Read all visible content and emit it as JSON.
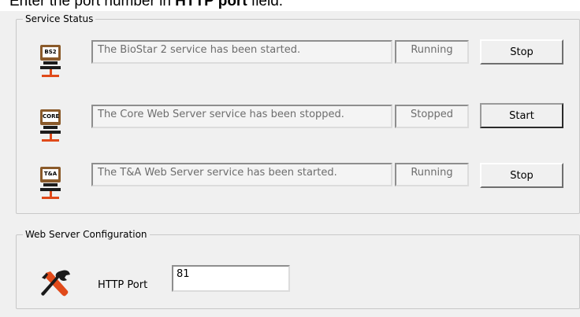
{
  "caption": {
    "before": "Enter the port number in ",
    "bold": "HTTP port",
    "after": " field."
  },
  "service_status": {
    "title": "Service Status",
    "services": [
      {
        "icon_text": "BS2",
        "icon": "bs2-server-icon",
        "message": "The BioStar 2 service has been started.",
        "status": "Running",
        "button": "Stop"
      },
      {
        "icon_text": "CORE",
        "icon": "core-server-icon",
        "message": "The Core Web Server service has been stopped.",
        "status": "Stopped",
        "button": "Start"
      },
      {
        "icon_text": "T&A",
        "icon": "ta-server-icon",
        "message": "The T&A Web Server service has been started.",
        "status": "Running",
        "button": "Stop"
      }
    ]
  },
  "web_server": {
    "title": "Web Server Configuration",
    "icon": "tools-icon",
    "port_label": "HTTP Port",
    "port_value": "81"
  },
  "colors": {
    "panel": "#f0f0f0",
    "group_border": "#c8c8c8",
    "icon_brown": "#8a5a2a",
    "network_orange": "#e04a1a",
    "tool_red": "#e04a1a"
  }
}
